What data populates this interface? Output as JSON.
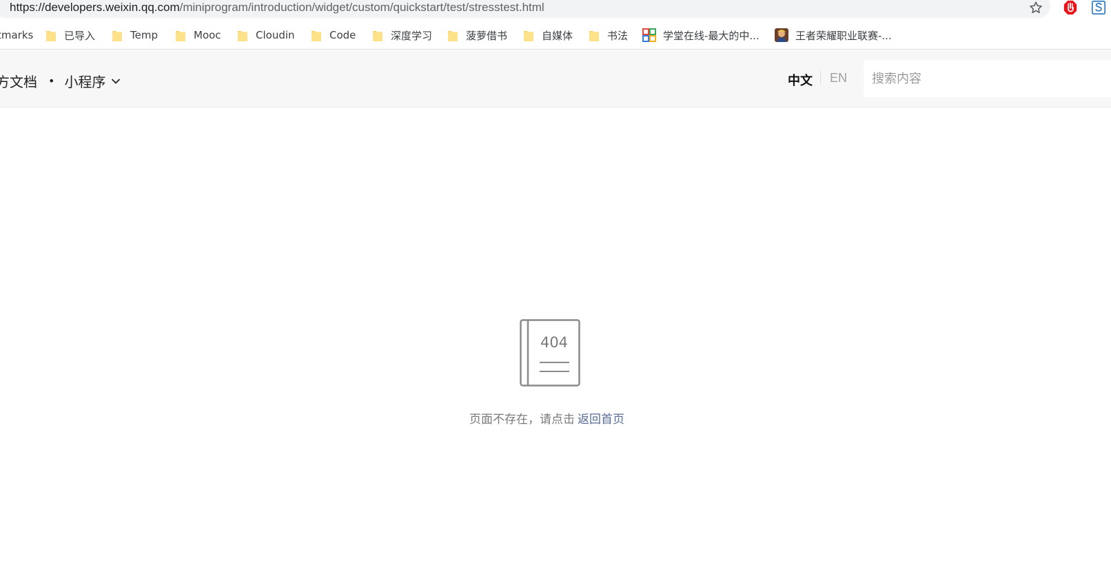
{
  "browser": {
    "url_host": "https://developers.weixin.qq.com",
    "url_path": "/miniprogram/introduction/widget/custom/quickstart/test/stresstest.html",
    "bookmarks": [
      {
        "label": "tmarks",
        "icon": "none"
      },
      {
        "label": "已导入",
        "icon": "folder-icon"
      },
      {
        "label": "Temp",
        "icon": "folder-icon"
      },
      {
        "label": "Mooc",
        "icon": "folder-icon"
      },
      {
        "label": "Cloudin",
        "icon": "folder-icon"
      },
      {
        "label": "Code",
        "icon": "folder-icon"
      },
      {
        "label": "深度学习",
        "icon": "folder-icon"
      },
      {
        "label": "菠萝借书",
        "icon": "folder-icon"
      },
      {
        "label": "自媒体",
        "icon": "folder-icon"
      },
      {
        "label": "书法",
        "icon": "folder-icon"
      },
      {
        "label": "学堂在线-最大的中...",
        "icon": "xuetang-favicon"
      },
      {
        "label": "王者荣耀职业联赛-...",
        "icon": "game-avatar-favicon"
      }
    ],
    "colors": {
      "folder": "#f9d66b",
      "ext_red": "#e8161b",
      "ext_blue": "#3b82c4"
    }
  },
  "header": {
    "title": "方文档",
    "product": "小程序",
    "lang_zh": "中文",
    "lang_en": "EN",
    "search_placeholder": "搜索内容"
  },
  "main": {
    "illustration_text": "404",
    "message": "页面不存在，请点击",
    "home_link": "返回首页",
    "link_color": "#576b95"
  }
}
